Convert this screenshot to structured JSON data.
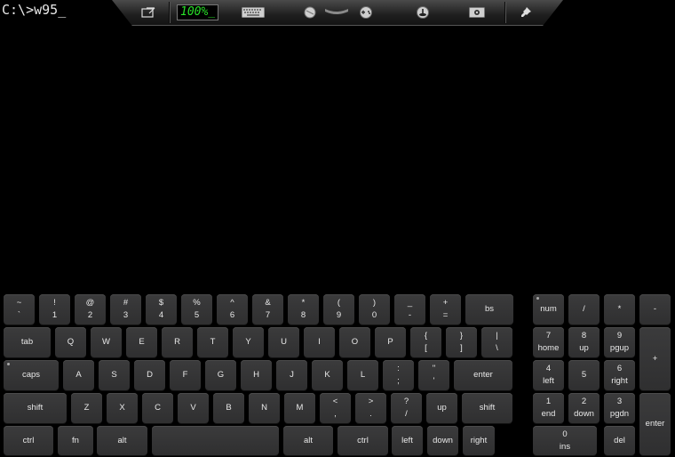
{
  "console": {
    "prompt": "C:\\>w95_"
  },
  "toolbar": {
    "speed": "100%_",
    "icons": [
      "exit-icon",
      "keyboard-icon",
      "mouse-icon",
      "gamepad-icon",
      "joystick-icon",
      "settings-icon",
      "pin-icon"
    ]
  },
  "main_keys": {
    "row1": [
      {
        "top": "~",
        "bottom": "`"
      },
      {
        "top": "!",
        "bottom": "1"
      },
      {
        "top": "@",
        "bottom": "2"
      },
      {
        "top": "#",
        "bottom": "3"
      },
      {
        "top": "$",
        "bottom": "4"
      },
      {
        "top": "%",
        "bottom": "5"
      },
      {
        "top": "^",
        "bottom": "6"
      },
      {
        "top": "&",
        "bottom": "7"
      },
      {
        "top": "*",
        "bottom": "8"
      },
      {
        "top": "(",
        "bottom": "9"
      },
      {
        "top": ")",
        "bottom": "0"
      },
      {
        "top": "_",
        "bottom": "-"
      },
      {
        "top": "+",
        "bottom": "="
      },
      {
        "top": "bs",
        "bottom": ""
      }
    ],
    "row2": [
      {
        "top": "tab",
        "bottom": ""
      },
      {
        "top": "Q",
        "bottom": ""
      },
      {
        "top": "W",
        "bottom": ""
      },
      {
        "top": "E",
        "bottom": ""
      },
      {
        "top": "R",
        "bottom": ""
      },
      {
        "top": "T",
        "bottom": ""
      },
      {
        "top": "Y",
        "bottom": ""
      },
      {
        "top": "U",
        "bottom": ""
      },
      {
        "top": "I",
        "bottom": ""
      },
      {
        "top": "O",
        "bottom": ""
      },
      {
        "top": "P",
        "bottom": ""
      },
      {
        "top": "{",
        "bottom": "["
      },
      {
        "top": "}",
        "bottom": "]"
      },
      {
        "top": "|",
        "bottom": "\\"
      }
    ],
    "row3": [
      {
        "top": "caps",
        "bottom": ""
      },
      {
        "top": "A",
        "bottom": ""
      },
      {
        "top": "S",
        "bottom": ""
      },
      {
        "top": "D",
        "bottom": ""
      },
      {
        "top": "F",
        "bottom": ""
      },
      {
        "top": "G",
        "bottom": ""
      },
      {
        "top": "H",
        "bottom": ""
      },
      {
        "top": "J",
        "bottom": ""
      },
      {
        "top": "K",
        "bottom": ""
      },
      {
        "top": "L",
        "bottom": ""
      },
      {
        "top": ":",
        "bottom": ";"
      },
      {
        "top": "\"",
        "bottom": "'"
      },
      {
        "top": "enter",
        "bottom": ""
      }
    ],
    "row4": [
      {
        "top": "shift",
        "bottom": ""
      },
      {
        "top": "Z",
        "bottom": ""
      },
      {
        "top": "X",
        "bottom": ""
      },
      {
        "top": "C",
        "bottom": ""
      },
      {
        "top": "V",
        "bottom": ""
      },
      {
        "top": "B",
        "bottom": ""
      },
      {
        "top": "N",
        "bottom": ""
      },
      {
        "top": "M",
        "bottom": ""
      },
      {
        "top": "<",
        "bottom": ","
      },
      {
        "top": ">",
        "bottom": "."
      },
      {
        "top": "?",
        "bottom": "/"
      },
      {
        "top": "up",
        "bottom": ""
      },
      {
        "top": "shift",
        "bottom": ""
      }
    ],
    "row5": [
      {
        "top": "ctrl",
        "bottom": ""
      },
      {
        "top": "fn",
        "bottom": ""
      },
      {
        "top": "alt",
        "bottom": ""
      },
      {
        "top": "",
        "bottom": ""
      },
      {
        "top": "alt",
        "bottom": ""
      },
      {
        "top": "ctrl",
        "bottom": ""
      },
      {
        "top": "left",
        "bottom": ""
      },
      {
        "top": "down",
        "bottom": ""
      },
      {
        "top": "right",
        "bottom": ""
      }
    ]
  },
  "numpad_keys": [
    {
      "top": "num",
      "bottom": ""
    },
    {
      "top": "/",
      "bottom": ""
    },
    {
      "top": "*",
      "bottom": ""
    },
    {
      "top": "-",
      "bottom": ""
    },
    {
      "top": "7",
      "bottom": "home"
    },
    {
      "top": "8",
      "bottom": "up"
    },
    {
      "top": "9",
      "bottom": "pgup"
    },
    {
      "top": "+",
      "bottom": ""
    },
    {
      "top": "4",
      "bottom": "left"
    },
    {
      "top": "5",
      "bottom": ""
    },
    {
      "top": "6",
      "bottom": "right"
    },
    {
      "top": "1",
      "bottom": "end"
    },
    {
      "top": "2",
      "bottom": "down"
    },
    {
      "top": "3",
      "bottom": "pgdn"
    },
    {
      "top": "enter",
      "bottom": ""
    },
    {
      "top": "0",
      "bottom": "ins"
    },
    {
      "top": "del",
      "bottom": ""
    }
  ]
}
